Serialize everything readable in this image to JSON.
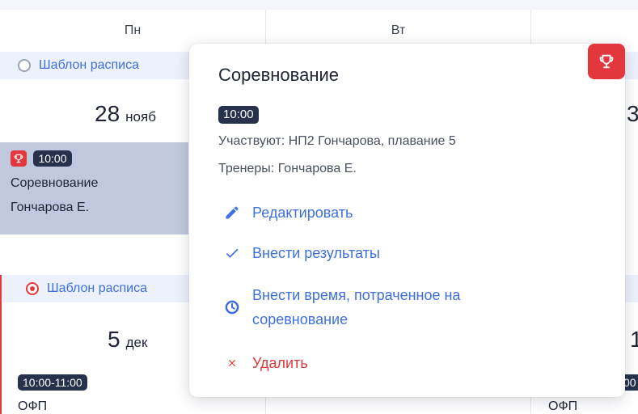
{
  "calendar": {
    "days": [
      "Пн",
      "Вт"
    ],
    "week1": {
      "template_label": "Шаблон расписа",
      "date_day": "28",
      "date_month": "нояб",
      "right_partial_digit": "3"
    },
    "event": {
      "time": "10:00",
      "title": "Соревнование",
      "coach": "Гончарова Е."
    },
    "week2": {
      "template_label": "Шаблон расписа",
      "date_day": "5",
      "date_month": "дек",
      "right_partial_digit": "1",
      "left_event_time": "10:00-11:00",
      "left_event_title": "ОФП",
      "right_event_time": "00",
      "right_event_title": "ОФП"
    }
  },
  "popup": {
    "title": "Соревнование",
    "time": "10:00",
    "participants": "Участвуют: НП2 Гончарова, плавание 5",
    "coaches": "Тренеры: Гончарова Е.",
    "actions": {
      "edit": "Редактировать",
      "results": "Внести результаты",
      "time_spent_line1": "Внести время, потраченное на",
      "time_spent_line2": "соревнование",
      "delete": "Удалить"
    }
  },
  "colors": {
    "accent": "#3d6fe0",
    "danger": "#e4373d",
    "badge": "#26314c",
    "event_bg": "#bfc8de"
  }
}
